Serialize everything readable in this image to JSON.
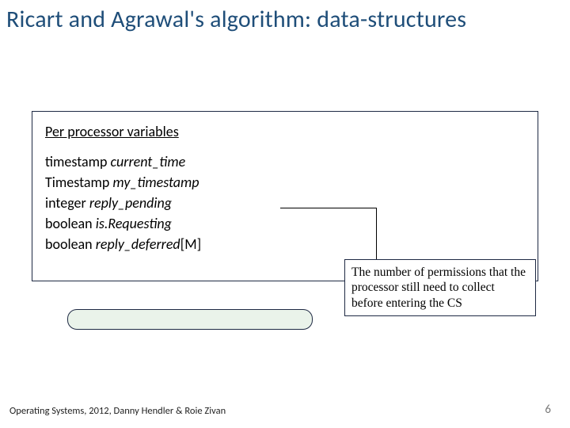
{
  "title": "Ricart and Agrawal's algorithm: data-structures",
  "box": {
    "heading": "Per processor variables",
    "lines": [
      {
        "type": "timestamp",
        "name": "current_time"
      },
      {
        "type": "Timestamp",
        "name": "my_timestamp"
      },
      {
        "type": "integer",
        "name": "reply_pending"
      },
      {
        "type": "boolean",
        "name": "is.Requesting"
      },
      {
        "type": "boolean",
        "name_prefix": "reply_deferred",
        "suffix": "[M]"
      }
    ]
  },
  "callout": "The number of permissions that the processor still need to collect before entering the CS",
  "footer": "Operating Systems, 2012, Danny Hendler & Roie Zivan",
  "pagenum": "6"
}
